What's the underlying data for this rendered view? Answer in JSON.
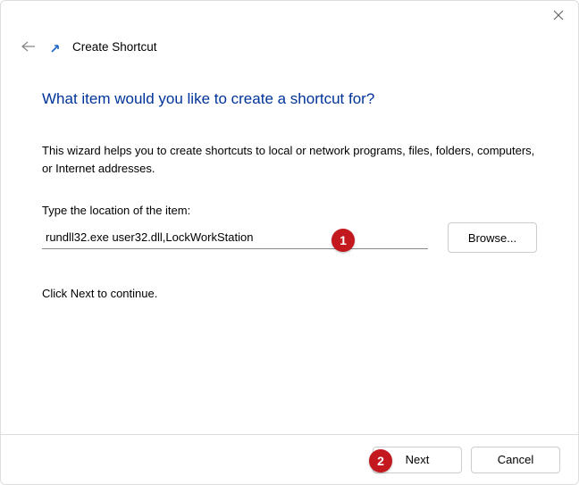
{
  "header": {
    "title": "Create Shortcut"
  },
  "main": {
    "heading": "What item would you like to create a shortcut for?",
    "description": "This wizard helps you to create shortcuts to local or network programs, files, folders, computers, or Internet addresses.",
    "field_label": "Type the location of the item:",
    "location_value": "rundll32.exe user32.dll,LockWorkStation",
    "browse_label": "Browse...",
    "continue_text": "Click Next to continue."
  },
  "footer": {
    "next_label": "Next",
    "cancel_label": "Cancel"
  },
  "annotations": {
    "badge1": "1",
    "badge2": "2"
  }
}
